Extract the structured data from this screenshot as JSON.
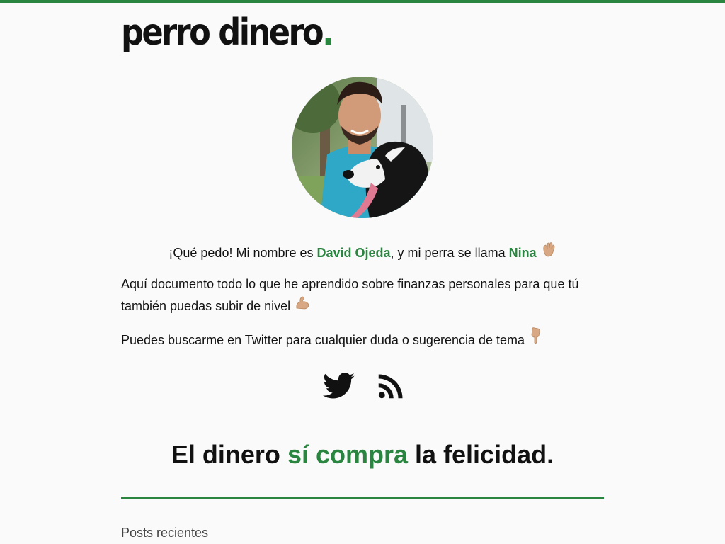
{
  "brand": {
    "name": "perro dinero",
    "dot": ".",
    "accent_color": "#2a8540"
  },
  "intro": {
    "prefix": "¡Qué pedo! Mi nombre es ",
    "author": "David Ojeda",
    "middle": ", y mi perra se llama ",
    "dog": "Nina",
    "emoji": "waving-hand"
  },
  "paragraph1": {
    "text": "Aquí documento todo lo que he aprendido sobre finanzas personales para que tú también puedas subir de nivel",
    "emoji": "flexed-biceps"
  },
  "paragraph2": {
    "text": "Puedes buscarme en Twitter para cualquier duda o sugerencia de tema",
    "emoji": "pointing-down"
  },
  "social": [
    {
      "icon": "twitter-icon"
    },
    {
      "icon": "rss-icon"
    }
  ],
  "tagline": {
    "start": "El dinero ",
    "highlight": "sí compra",
    "end": " la felicidad."
  },
  "recent_posts": {
    "heading": "Posts recientes"
  }
}
